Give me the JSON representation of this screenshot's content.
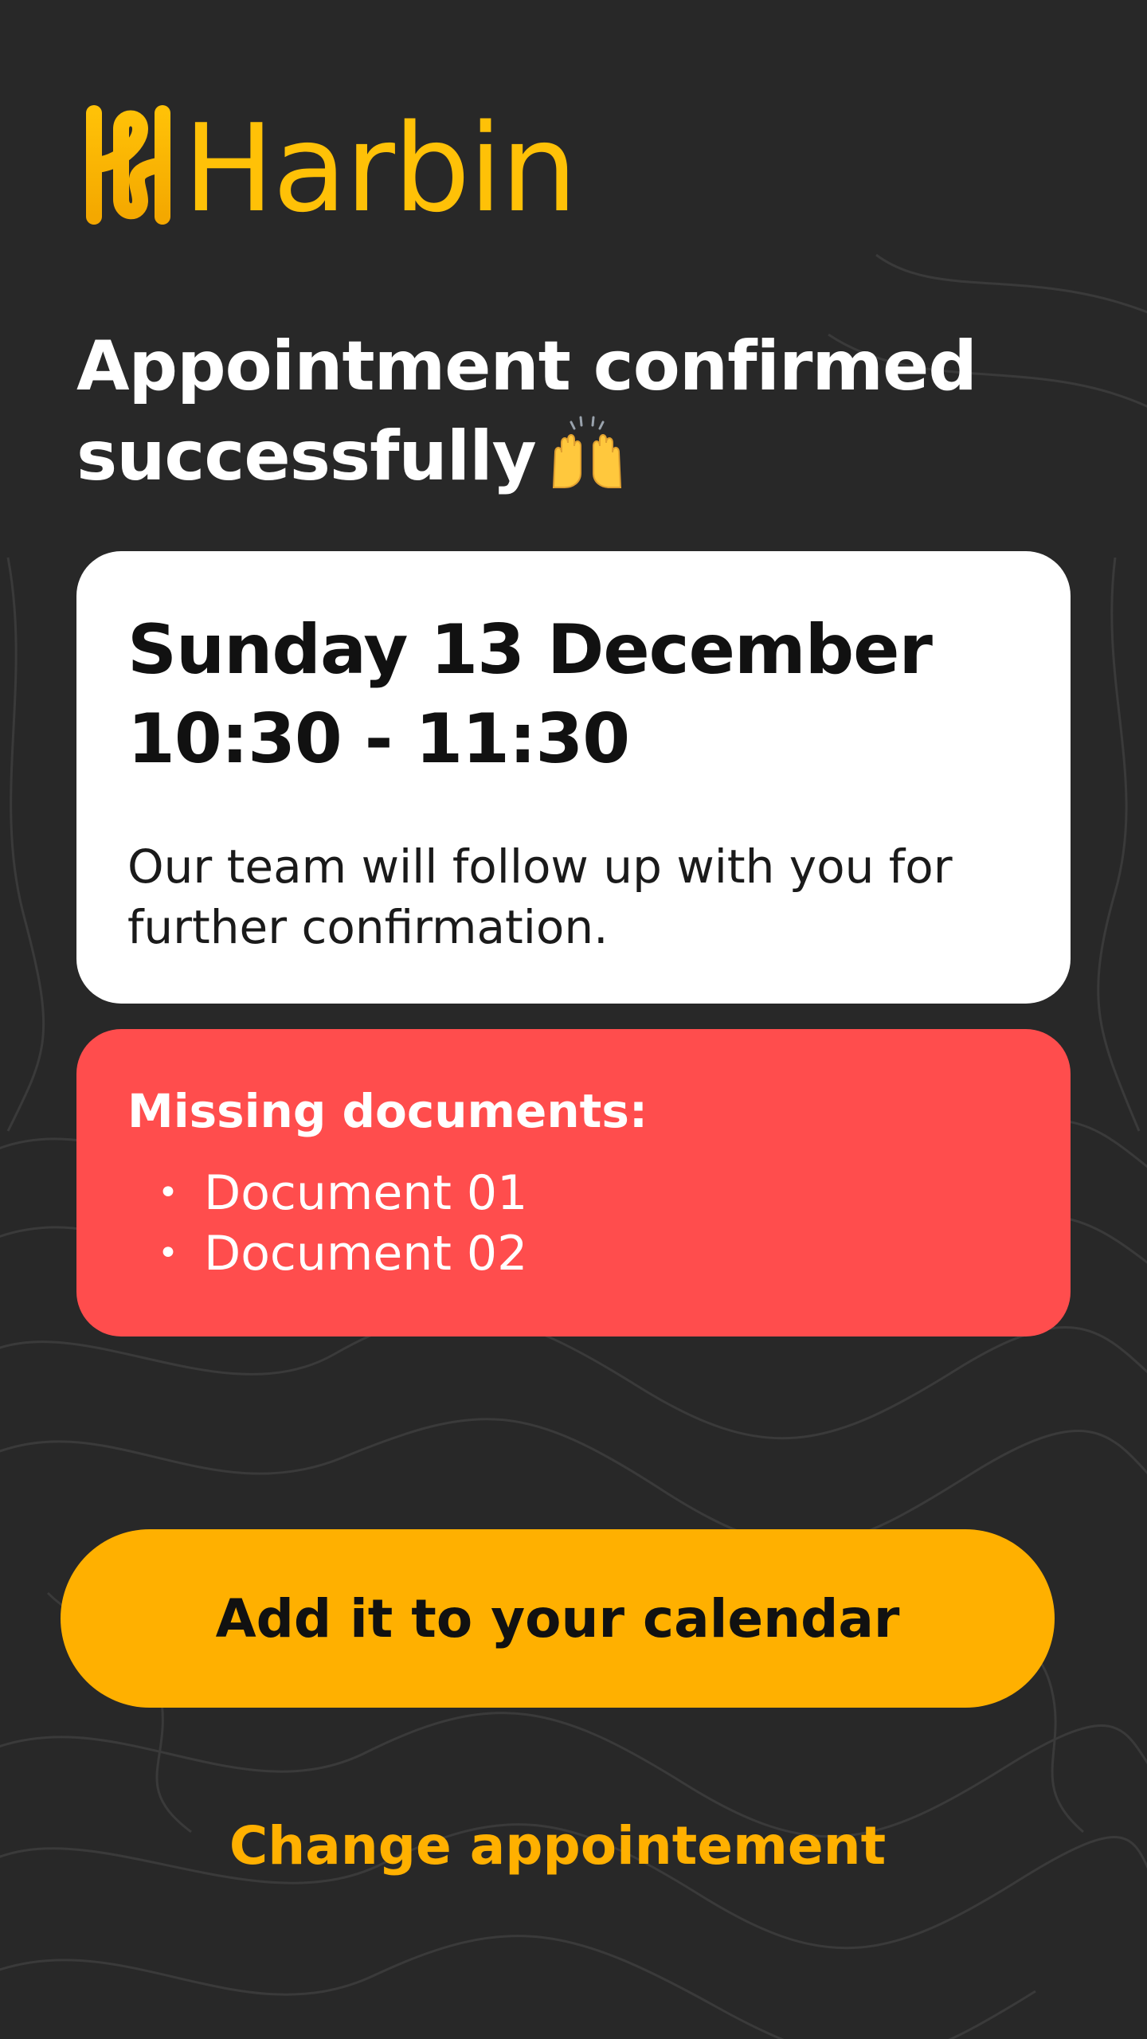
{
  "brand": {
    "name": "Harbin",
    "logo_icon": "harbin-logo-mark",
    "color": "#FFC107"
  },
  "headline": {
    "text": "Appointment confirmed successfully",
    "emoji_icon": "raising-hands-icon"
  },
  "appointment": {
    "date": "Sunday 13 December",
    "time": "10:30 - 11:30",
    "note": "Our team will follow up with you for further confirmation."
  },
  "missing_documents": {
    "title": "Missing documents:",
    "items": [
      "Document 01",
      "Document 02"
    ],
    "color": "#FF4D4D"
  },
  "actions": {
    "primary_label": "Add it to your calendar",
    "primary_color": "#FFB000",
    "secondary_label": "Change appointement"
  },
  "colors": {
    "background": "#282828",
    "card": "#FFFFFF"
  }
}
